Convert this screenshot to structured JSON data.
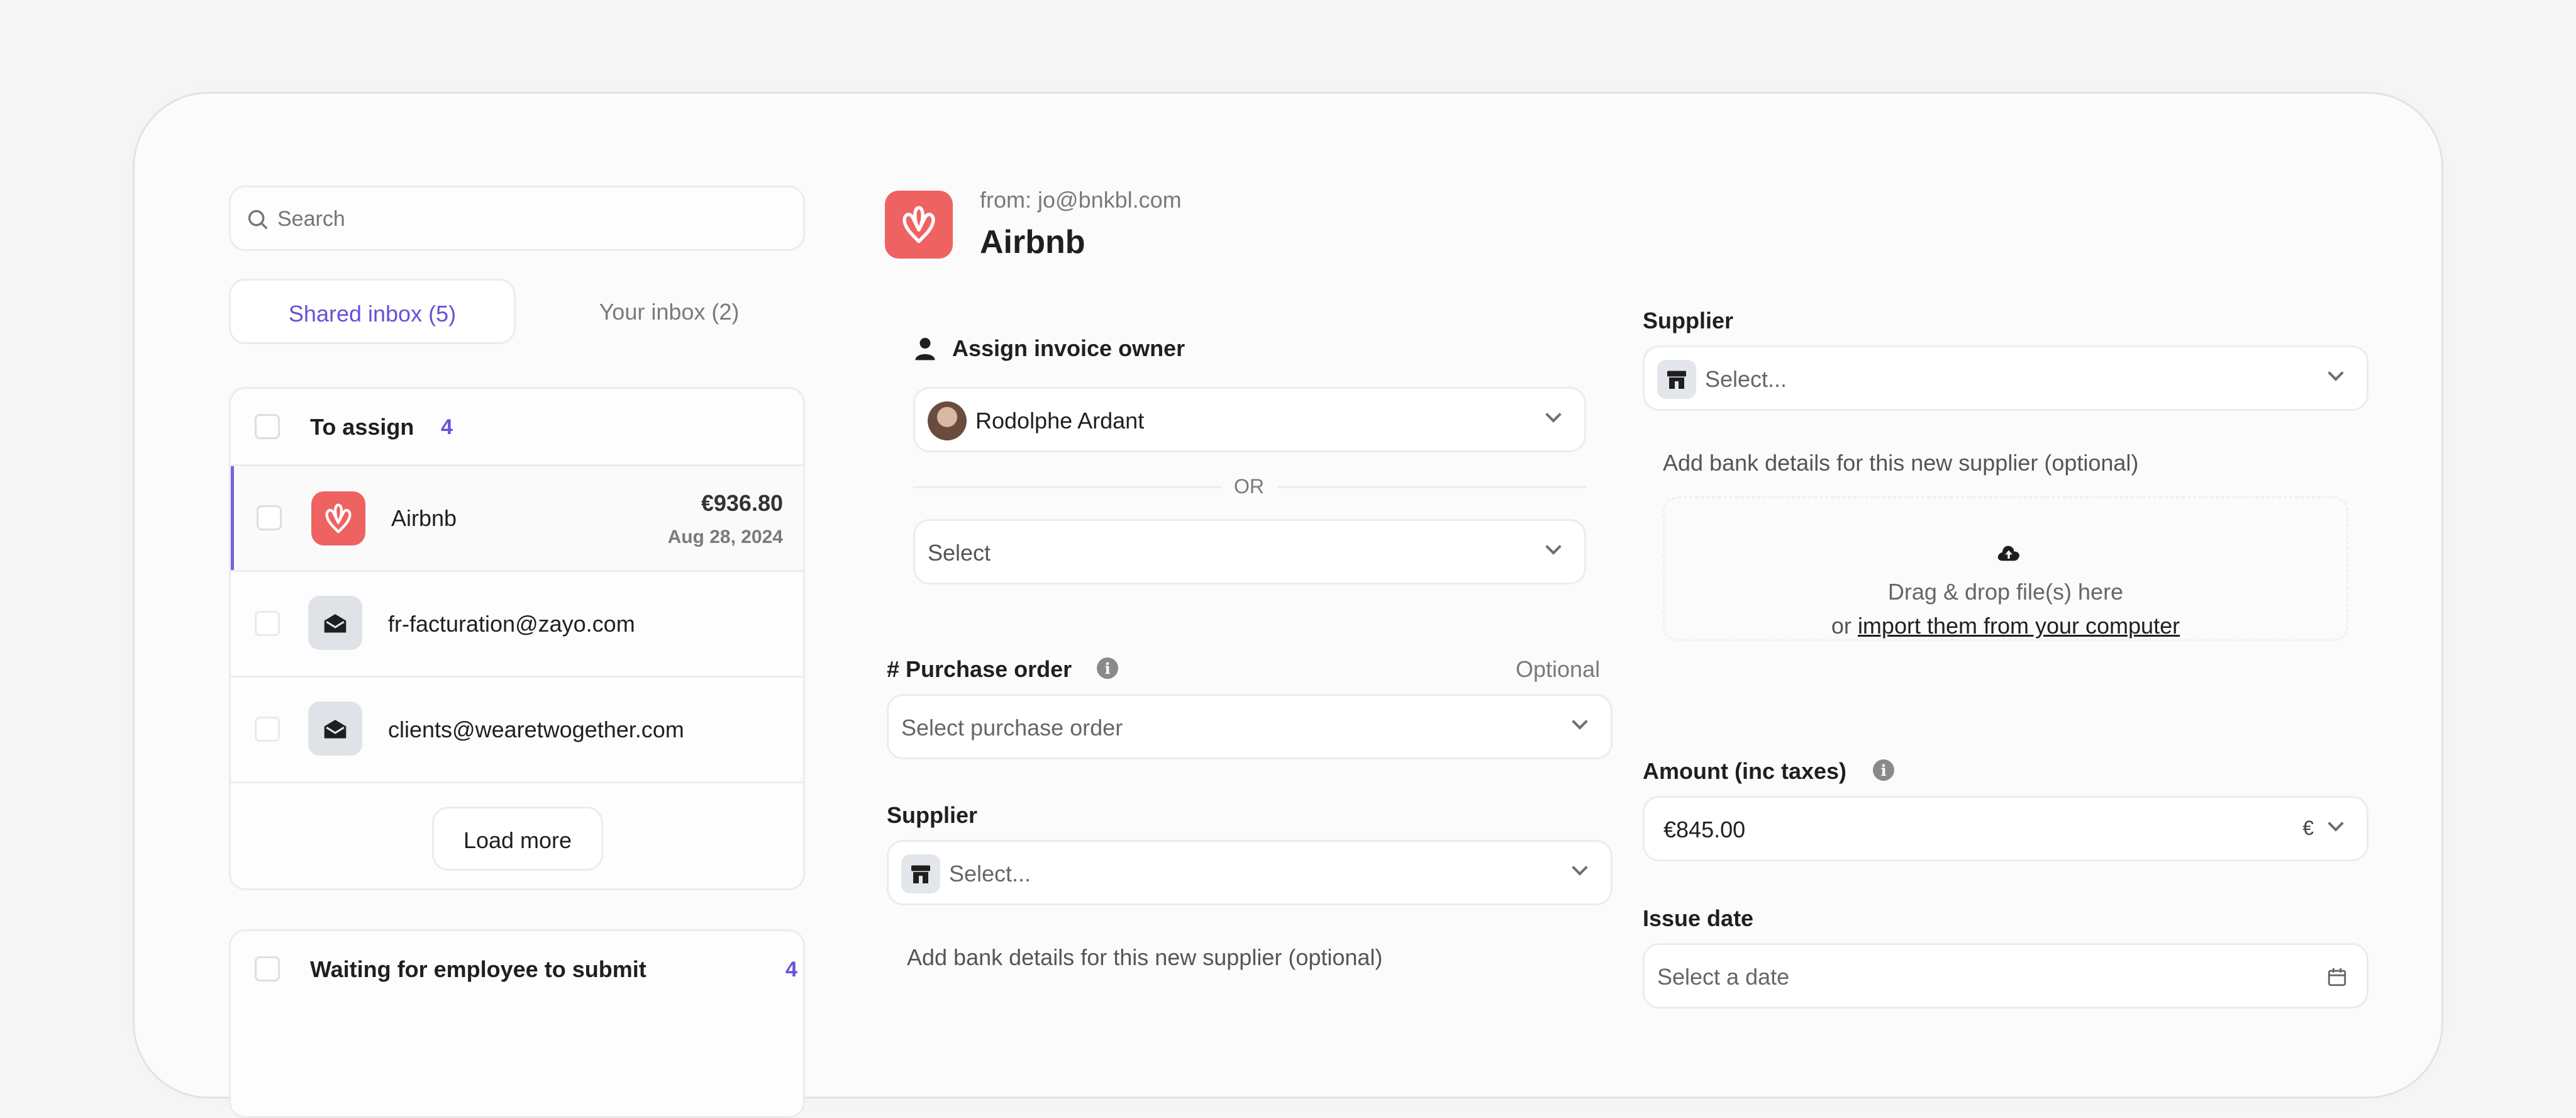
{
  "search": {
    "placeholder": "Search"
  },
  "inbox_tabs": [
    {
      "label": "Shared inbox (5)",
      "active": true
    },
    {
      "label": "Your inbox (2)",
      "active": false
    }
  ],
  "to_assign": {
    "title": "To assign",
    "count": "4",
    "items": [
      {
        "name": "Airbnb",
        "amount": "€936.80",
        "date": "Aug 28, 2024",
        "icon": "airbnb-logo"
      },
      {
        "name": "fr-facturation@zayo.com",
        "icon": "mail-icon"
      },
      {
        "name": "clients@wearetwogether.com",
        "icon": "mail-icon"
      }
    ],
    "load_more": "Load more"
  },
  "waiting": {
    "title": "Waiting for employee to submit",
    "count": "4"
  },
  "detail": {
    "from": "from: jo@bnkbl.com",
    "title": "Airbnb",
    "assign_label": "Assign invoice owner",
    "owner": "Rodolphe Ardant",
    "or": "OR",
    "select_placeholder": "Select",
    "po_label": "# Purchase order",
    "po_optional": "Optional",
    "po_placeholder": "Select purchase order",
    "supplier_label": "Supplier",
    "supplier_placeholder": "Select...",
    "bank_details": "Add bank details for this new supplier (optional)"
  },
  "right": {
    "supplier_label": "Supplier",
    "supplier_placeholder": "Select...",
    "bank_details": "Add bank details for this new supplier (optional)",
    "dropzone_line1": "Drag & drop file(s) here",
    "dropzone_or": "or",
    "dropzone_link": "import them from your computer",
    "amount_label": "Amount (inc taxes)",
    "amount_value": "€845.00",
    "currency": "€",
    "issue_label": "Issue date",
    "issue_placeholder": "Select a date"
  },
  "colors": {
    "accent": "#6a4fd8",
    "airbnb": "#ef6262"
  }
}
